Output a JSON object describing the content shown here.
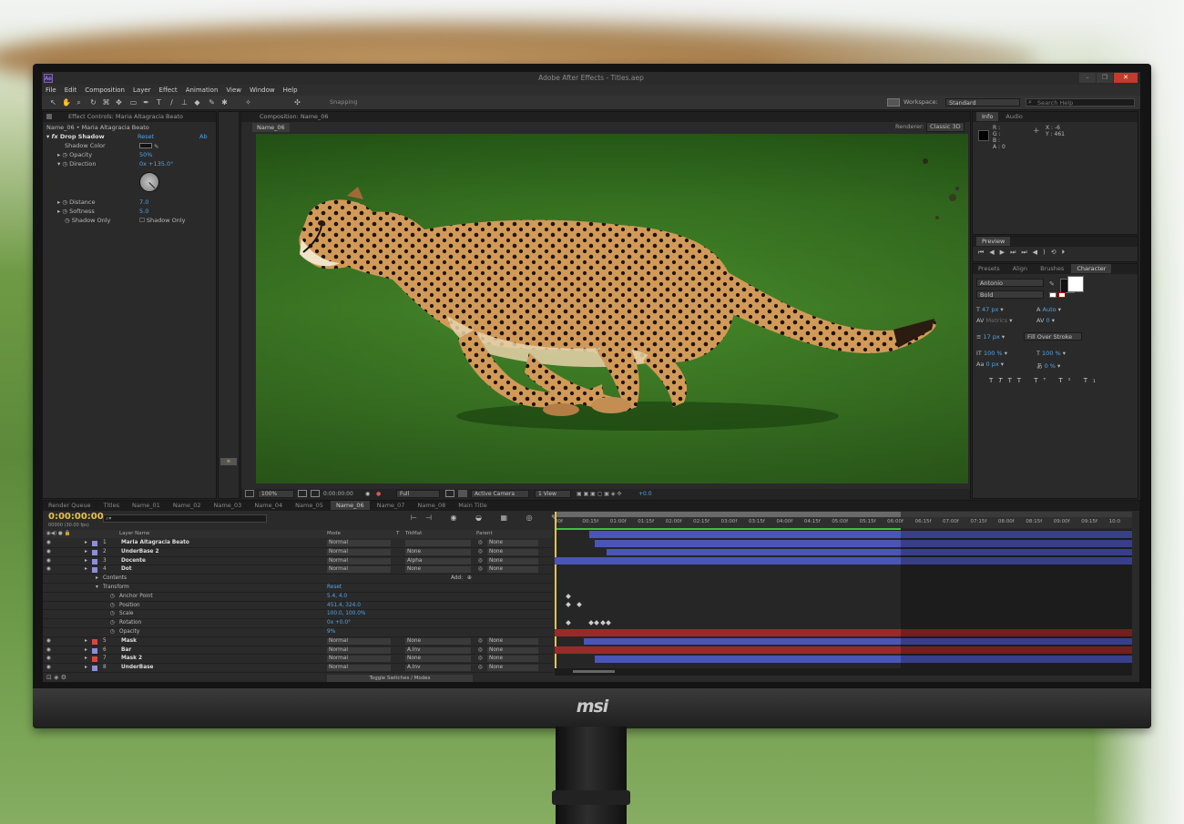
{
  "app": {
    "window_title": "Adobe After Effects - Titles.aep",
    "brand_logo": "msi",
    "menu": [
      "File",
      "Edit",
      "Composition",
      "Layer",
      "Effect",
      "Animation",
      "View",
      "Window",
      "Help"
    ],
    "snapping_label": "Snapping",
    "workspace_label": "Workspace:",
    "workspace_value": "Standard",
    "search_help_placeholder": "Search Help"
  },
  "effect_controls": {
    "tab_label": "Effect Controls: Maria Altagracia Beato",
    "breadcrumb": "Name_06 • Maria Altagracia Beato",
    "effect_name": "Drop Shadow",
    "reset_label": "Reset",
    "about_label": "Ab",
    "props": [
      {
        "name": "Shadow Color",
        "value": ""
      },
      {
        "name": "Opacity",
        "value": "50%"
      },
      {
        "name": "Direction",
        "value": "0x +135.0°"
      },
      {
        "name": "Distance",
        "value": "7.0"
      },
      {
        "name": "Softness",
        "value": "5.0"
      },
      {
        "name": "Shadow Only",
        "value": "Shadow Only"
      }
    ]
  },
  "composition": {
    "tab_label": "Composition: Name_06",
    "sub_tab": "Name_06",
    "renderer_label": "Renderer:",
    "renderer_value": "Classic 3D",
    "footer": {
      "zoom": "100%",
      "timecode": "0:00:00:00",
      "resolution": "Full",
      "camera": "Active Camera",
      "views": "1 View",
      "exposure": "+0.0"
    }
  },
  "info_panel": {
    "tabs": [
      "Info",
      "Audio"
    ],
    "r": "R :",
    "g": "G :",
    "b": "B :",
    "a": "A : 0",
    "x": "X : -6",
    "y": "Y : 461"
  },
  "preview_panel": {
    "title": "Preview"
  },
  "character_panel": {
    "tabs": [
      "Presets",
      "Align",
      "Brushes",
      "Character"
    ],
    "font": "Antonio",
    "style": "Bold",
    "size": "47 px",
    "leading": "Auto",
    "kerning": "Metrics",
    "tracking": "0",
    "stroke": "17 px",
    "stroke_mode": "Fill Over Stroke",
    "vscale": "100 %",
    "hscale": "100 %",
    "baseline": "0 px",
    "tsume": "0 %"
  },
  "timeline": {
    "tabs": [
      "Render Queue",
      "Titles",
      "Name_01",
      "Name_02",
      "Name_03",
      "Name_04",
      "Name_05",
      "Name_06",
      "Name_07",
      "Name_08",
      "Main Title"
    ],
    "active_tab": "Name_06",
    "timecode": "0:00:00:00",
    "frame_info": "00000 (30.00 fps)",
    "col_layer_name": "Layer Name",
    "col_mode": "Mode",
    "col_t": "T",
    "col_trkmat": "TrkMat",
    "col_parent": "Parent",
    "ruler": [
      "00f",
      "00:15f",
      "01:00f",
      "01:15f",
      "02:00f",
      "02:15f",
      "03:00f",
      "03:15f",
      "04:00f",
      "04:15f",
      "05:00f",
      "05:15f",
      "06:00f",
      "06:15f",
      "07:00f",
      "07:15f",
      "08:00f",
      "08:15f",
      "09:00f",
      "09:15f",
      "10:0"
    ],
    "layers": [
      {
        "num": "1",
        "name": "Maria Altagracia Beato",
        "mode": "Normal",
        "trkmat": "",
        "parent": "None",
        "color": "#8e8ed8"
      },
      {
        "num": "2",
        "name": "UnderBase 2",
        "mode": "Normal",
        "trkmat": "None",
        "parent": "None",
        "color": "#8e8ed8"
      },
      {
        "num": "3",
        "name": "Docente",
        "mode": "Normal",
        "trkmat": "Alpha",
        "parent": "None",
        "color": "#8e8ed8"
      },
      {
        "num": "4",
        "name": "Dot",
        "mode": "Normal",
        "trkmat": "None",
        "parent": "None",
        "color": "#8e8ed8"
      },
      {
        "num": "5",
        "name": "Mask",
        "mode": "Normal",
        "trkmat": "None",
        "parent": "None",
        "color": "#d94545"
      },
      {
        "num": "6",
        "name": "Bar",
        "mode": "Normal",
        "trkmat": "A.Inv",
        "parent": "None",
        "color": "#8e8ed8"
      },
      {
        "num": "7",
        "name": "Mask 2",
        "mode": "Normal",
        "trkmat": "None",
        "parent": "None",
        "color": "#d94545"
      },
      {
        "num": "8",
        "name": "UnderBase",
        "mode": "Normal",
        "trkmat": "A.Inv",
        "parent": "None",
        "color": "#8e8ed8"
      }
    ],
    "contents_label": "Contents",
    "add_label": "Add:",
    "transform_label": "Transform",
    "transform_reset": "Reset",
    "transform_props": [
      {
        "name": "Anchor Point",
        "value": "5.4, 4.0"
      },
      {
        "name": "Position",
        "value": "451.4, 324.0"
      },
      {
        "name": "Scale",
        "value": "100.0, 100.0%"
      },
      {
        "name": "Rotation",
        "value": "0x +0.0°"
      },
      {
        "name": "Opacity",
        "value": "9%"
      }
    ],
    "toggle_label": "Toggle Switches / Modes"
  }
}
